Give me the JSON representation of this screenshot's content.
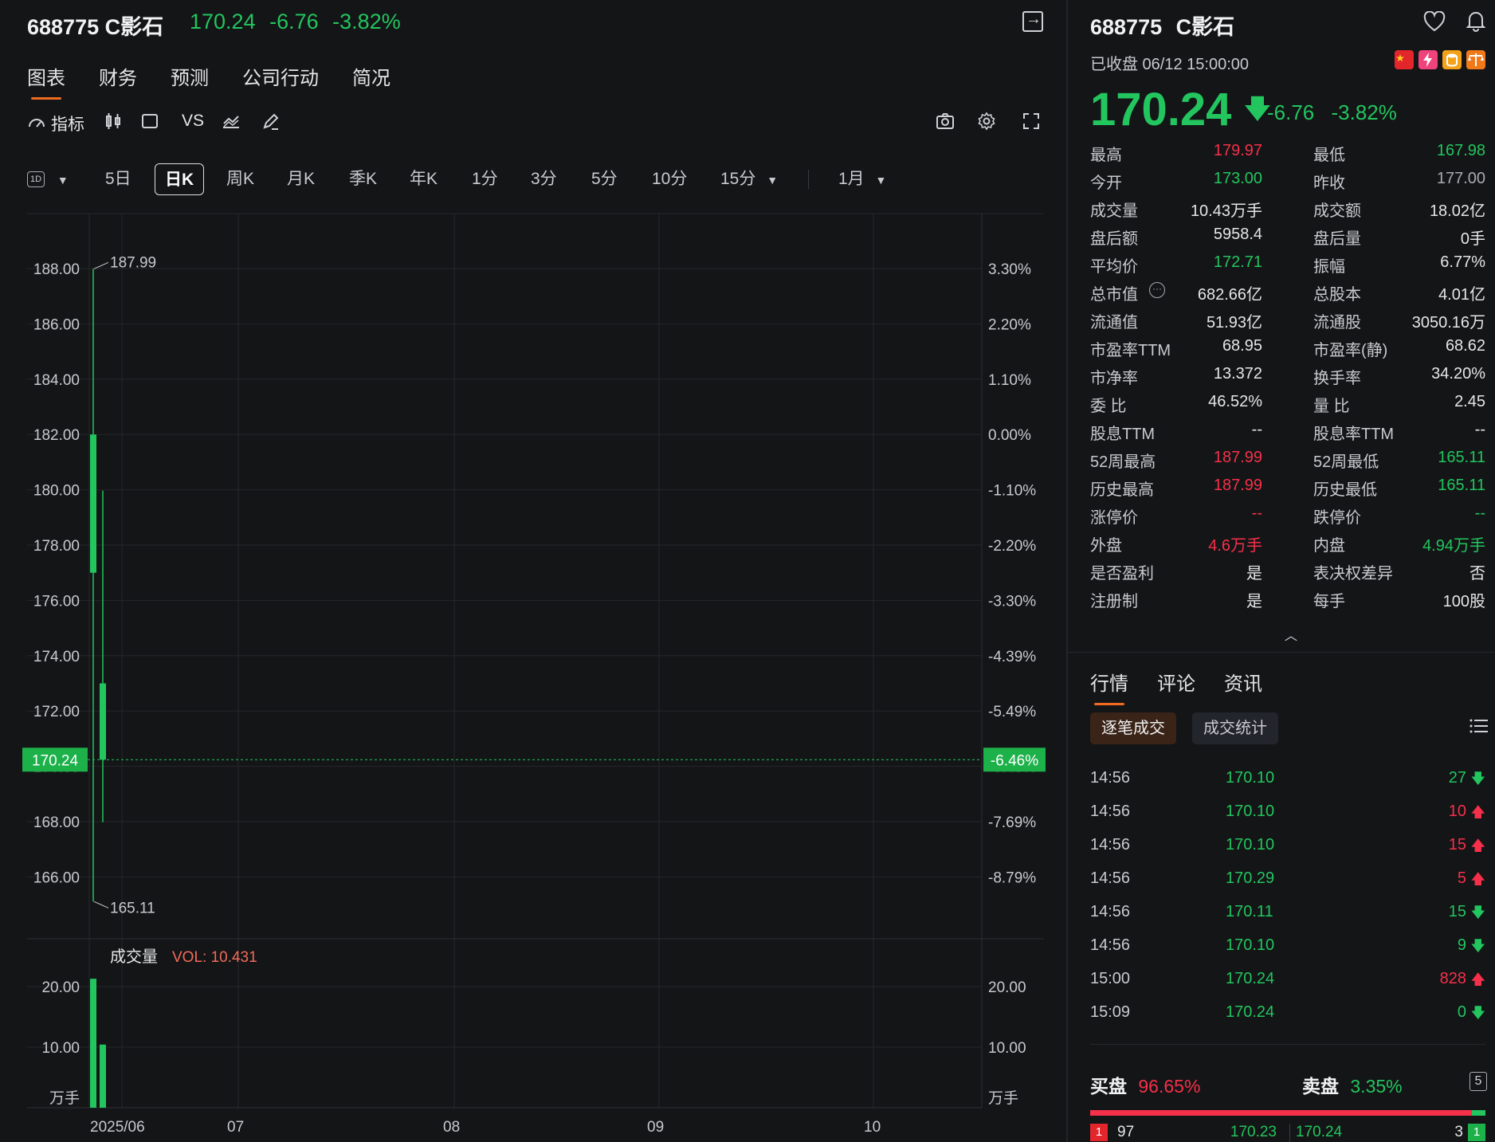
{
  "header": {
    "code": "688775",
    "name": "C影石",
    "price": "170.24",
    "change": "-6.76",
    "change_pct": "-3.82%"
  },
  "tabs": [
    "图表",
    "财务",
    "预测",
    "公司行动",
    "简况"
  ],
  "toolbar": {
    "indicator_label": "指标",
    "vs_label": "VS"
  },
  "periods": {
    "interval_badge": "1D",
    "items": [
      "5日",
      "日K",
      "周K",
      "月K",
      "季K",
      "年K",
      "1分",
      "3分",
      "5分",
      "10分",
      "15分"
    ],
    "range": "1月"
  },
  "chart_data": {
    "type": "candlestick",
    "price_ticks": [
      "188.00",
      "186.00",
      "184.00",
      "182.00",
      "180.00",
      "178.00",
      "176.00",
      "174.00",
      "172.00",
      "170.00",
      "168.00",
      "166.00"
    ],
    "pct_ticks": [
      "3.30%",
      "2.20%",
      "1.10%",
      "0.00%",
      "-1.10%",
      "-2.20%",
      "-3.30%",
      "-4.39%",
      "-5.49%",
      "-6.46%",
      "-7.69%",
      "-8.79%"
    ],
    "current_price_label": "170.24",
    "current_pct_label": "-6.46%",
    "high_annotation": "187.99",
    "low_annotation": "165.11",
    "x_labels": [
      "2025/06",
      "07",
      "08",
      "09",
      "10"
    ],
    "candles": [
      {
        "date": "2025/06/11",
        "open": 182.0,
        "high": 187.99,
        "low": 165.11,
        "close": 177.0
      },
      {
        "date": "2025/06/12",
        "open": 173.0,
        "high": 179.97,
        "low": 167.98,
        "close": 170.24
      }
    ],
    "volume": {
      "title": "成交量",
      "label": "VOL: 10.431",
      "ticks": [
        "20.00",
        "10.00",
        "万手"
      ],
      "values": [
        21.3,
        10.43
      ]
    }
  },
  "quote": {
    "title_code": "688775",
    "title_name": "C影石",
    "status": "已收盘 06/12 15:00:00",
    "price": "170.24",
    "change": "-6.76",
    "change_pct": "-3.82%",
    "stats": [
      {
        "l1": "最高",
        "v1": "179.97",
        "c1": "up",
        "l2": "最低",
        "v2": "167.98",
        "c2": "down"
      },
      {
        "l1": "今开",
        "v1": "173.00",
        "c1": "down",
        "l2": "昨收",
        "v2": "177.00",
        "c2": "muted"
      },
      {
        "l1": "成交量",
        "v1": "10.43万手",
        "c1": "",
        "l2": "成交额",
        "v2": "18.02亿",
        "c2": ""
      },
      {
        "l1": "盘后额",
        "v1": "5958.4",
        "c1": "",
        "l2": "盘后量",
        "v2": "0手",
        "c2": ""
      },
      {
        "l1": "平均价",
        "v1": "172.71",
        "c1": "down",
        "l2": "振幅",
        "v2": "6.77%",
        "c2": ""
      },
      {
        "l1": "总市值",
        "v1": "682.66亿",
        "c1": "",
        "l2": "总股本",
        "v2": "4.01亿",
        "c2": ""
      },
      {
        "l1": "流通值",
        "v1": "51.93亿",
        "c1": "",
        "l2": "流通股",
        "v2": "3050.16万",
        "c2": ""
      },
      {
        "l1": "市盈率TTM",
        "v1": "68.95",
        "c1": "",
        "l2": "市盈率(静)",
        "v2": "68.62",
        "c2": ""
      },
      {
        "l1": "市净率",
        "v1": "13.372",
        "c1": "",
        "l2": "换手率",
        "v2": "34.20%",
        "c2": ""
      },
      {
        "l1": "委 比",
        "v1": "46.52%",
        "c1": "",
        "l2": "量 比",
        "v2": "2.45",
        "c2": ""
      },
      {
        "l1": "股息TTM",
        "v1": "--",
        "c1": "",
        "l2": "股息率TTM",
        "v2": "--",
        "c2": ""
      },
      {
        "l1": "52周最高",
        "v1": "187.99",
        "c1": "up",
        "l2": "52周最低",
        "v2": "165.11",
        "c2": "down"
      },
      {
        "l1": "历史最高",
        "v1": "187.99",
        "c1": "up",
        "l2": "历史最低",
        "v2": "165.11",
        "c2": "down"
      },
      {
        "l1": "涨停价",
        "v1": "--",
        "c1": "up",
        "l2": "跌停价",
        "v2": "--",
        "c2": "down"
      },
      {
        "l1": "外盘",
        "v1": "4.6万手",
        "c1": "up",
        "l2": "内盘",
        "v2": "4.94万手",
        "c2": "down"
      },
      {
        "l1": "是否盈利",
        "v1": "是",
        "c1": "",
        "l2": "表决权差异",
        "v2": "否",
        "c2": ""
      },
      {
        "l1": "注册制",
        "v1": "是",
        "c1": "",
        "l2": "每手",
        "v2": "100股",
        "c2": ""
      }
    ]
  },
  "market_tabs": [
    "行情",
    "评论",
    "资讯"
  ],
  "subtabs": {
    "ticks": "逐笔成交",
    "stats": "成交统计"
  },
  "trades": [
    {
      "time": "14:56",
      "price": "170.10",
      "qty": "27",
      "dir": "down"
    },
    {
      "time": "14:56",
      "price": "170.10",
      "qty": "10",
      "dir": "up"
    },
    {
      "time": "14:56",
      "price": "170.10",
      "qty": "15",
      "dir": "up"
    },
    {
      "time": "14:56",
      "price": "170.29",
      "qty": "5",
      "dir": "up"
    },
    {
      "time": "14:56",
      "price": "170.11",
      "qty": "15",
      "dir": "down"
    },
    {
      "time": "14:56",
      "price": "170.10",
      "qty": "9",
      "dir": "down"
    },
    {
      "time": "15:00",
      "price": "170.24",
      "qty": "828",
      "dir": "up"
    },
    {
      "time": "15:09",
      "price": "170.24",
      "qty": "0",
      "dir": "down"
    }
  ],
  "orderbook": {
    "buy_label": "买盘",
    "buy_pct": "96.65%",
    "buy_ratio": 0.9665,
    "sell_label": "卖盘",
    "sell_pct": "3.35%",
    "depth_badge": "5",
    "bid_level": "1",
    "bid_qty": "97",
    "bid_price": "170.23",
    "ask_price": "170.24",
    "ask_qty": "3",
    "ask_level": "1"
  },
  "colors": {
    "up": "#f5304a",
    "down": "#22c55e",
    "accent": "#f06a1f"
  }
}
